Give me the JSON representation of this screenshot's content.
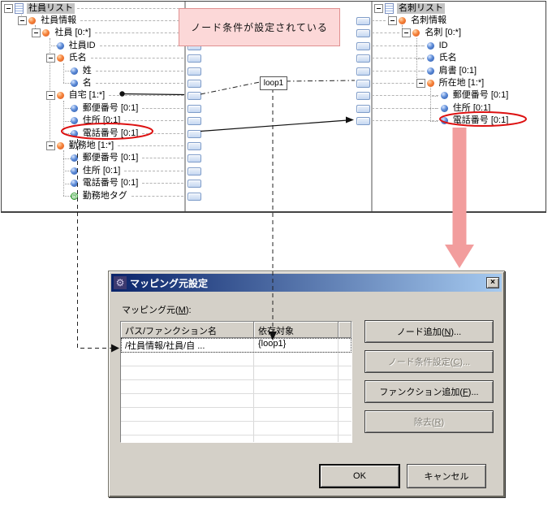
{
  "mapping_view": {
    "callout_text": "ノード条件が設定されている",
    "loop_label": "loop1",
    "source_tree": {
      "nodes": [
        {
          "label": "社員リスト",
          "level": 0,
          "icon": "document",
          "expand": true,
          "selected": true
        },
        {
          "label": "社員情報",
          "level": 1,
          "icon": "element",
          "expand": true
        },
        {
          "label": "社員 [0:*]",
          "level": 2,
          "icon": "element",
          "expand": true
        },
        {
          "label": "社員ID",
          "level": 3,
          "icon": "field"
        },
        {
          "label": "氏名",
          "level": 3,
          "icon": "element",
          "expand": true
        },
        {
          "label": "姓",
          "level": 4,
          "icon": "field"
        },
        {
          "label": "名",
          "level": 4,
          "icon": "field"
        },
        {
          "label": "自宅 [1:*]",
          "level": 3,
          "icon": "element",
          "expand": true
        },
        {
          "label": "郵便番号 [0:1]",
          "level": 4,
          "icon": "field"
        },
        {
          "label": "住所 [0:1]",
          "level": 4,
          "icon": "field"
        },
        {
          "label": "電話番号 [0:1]",
          "level": 4,
          "icon": "field",
          "circled": true
        },
        {
          "label": "勤務地 [1:*]",
          "level": 3,
          "icon": "element",
          "expand": true
        },
        {
          "label": "郵便番号 [0:1]",
          "level": 4,
          "icon": "field"
        },
        {
          "label": "住所 [0:1]",
          "level": 4,
          "icon": "field"
        },
        {
          "label": "電話番号 [0:1]",
          "level": 4,
          "icon": "field"
        },
        {
          "label": "勤務地タグ",
          "level": 4,
          "icon": "attribute"
        }
      ]
    },
    "target_tree": {
      "nodes": [
        {
          "label": "名刺リスト",
          "level": 0,
          "icon": "document",
          "expand": true,
          "selected": true
        },
        {
          "label": "名刺情報",
          "level": 1,
          "icon": "element",
          "expand": true
        },
        {
          "label": "名刺 [0:*]",
          "level": 2,
          "icon": "element",
          "expand": true
        },
        {
          "label": "ID",
          "level": 3,
          "icon": "field"
        },
        {
          "label": "氏名",
          "level": 3,
          "icon": "field"
        },
        {
          "label": "肩書 [0:1]",
          "level": 3,
          "icon": "field"
        },
        {
          "label": "所在地 [1:*]",
          "level": 3,
          "icon": "element",
          "expand": true
        },
        {
          "label": "郵便番号 [0:1]",
          "level": 4,
          "icon": "field"
        },
        {
          "label": "住所 [0:1]",
          "level": 4,
          "icon": "field"
        },
        {
          "label": "電話番号 [0:1]",
          "level": 4,
          "icon": "field",
          "circled": true
        }
      ]
    }
  },
  "dialog": {
    "title": "マッピング元設定",
    "close_glyph": "×",
    "source_list_label": "マッピング元(M):",
    "table": {
      "columns": [
        "パス/ファンクション名",
        "依存対象"
      ],
      "rows": [
        {
          "path": "/社員情報/社員/自 ...",
          "dependency": "{loop1}"
        }
      ],
      "empty_rows": 7
    },
    "buttons": [
      {
        "label": "ノード追加(N)...",
        "enabled": true
      },
      {
        "label": "ノード条件設定(C)...",
        "enabled": false
      },
      {
        "label": "ファンクション追加(F)...",
        "enabled": true
      },
      {
        "label": "除去(R)",
        "enabled": false
      }
    ],
    "ok_label": "OK",
    "cancel_label": "キャンセル"
  },
  "colors": {
    "titlebar_gradient_start": "#0A246A",
    "titlebar_gradient_end": "#A6CAF0",
    "callout_bg": "#FCD8D8",
    "annotation_red": "#DD1111",
    "flow_arrow_pink": "#F29D9D",
    "port_blue": "#C9D9F2",
    "dialog_bg": "#D4D0C8",
    "selection_gray": "#C3C3C3"
  }
}
